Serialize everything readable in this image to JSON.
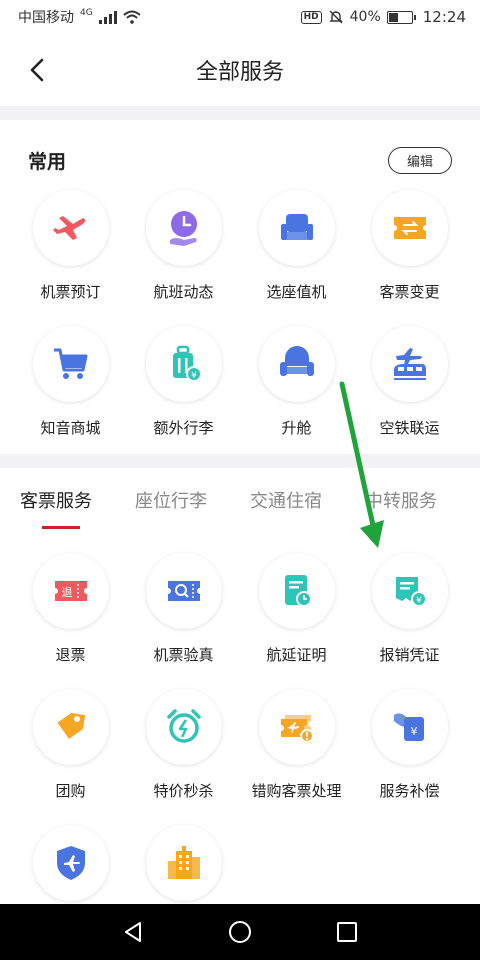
{
  "status": {
    "carrier": "中国移动",
    "network": "4G",
    "battery": "40%",
    "battery_level": 0.4,
    "time": "12:24",
    "hd": "HD"
  },
  "header": {
    "title": "全部服务"
  },
  "common": {
    "title": "常用",
    "edit": "编辑",
    "items": [
      {
        "label": "机票预订",
        "icon": "plane-icon"
      },
      {
        "label": "航班动态",
        "icon": "clock-hand-icon"
      },
      {
        "label": "选座值机",
        "icon": "seat-icon"
      },
      {
        "label": "客票变更",
        "icon": "ticket-exchange-icon"
      },
      {
        "label": "知音商城",
        "icon": "cart-icon"
      },
      {
        "label": "额外行李",
        "icon": "luggage-icon"
      },
      {
        "label": "升舱",
        "icon": "armchair-icon"
      },
      {
        "label": "空铁联运",
        "icon": "plane-train-icon"
      }
    ]
  },
  "tabs": [
    {
      "label": "客票服务"
    },
    {
      "label": "座位行李"
    },
    {
      "label": "交通住宿"
    },
    {
      "label": "中转服务"
    }
  ],
  "services": {
    "items": [
      {
        "label": "退票",
        "icon": "refund-ticket-icon"
      },
      {
        "label": "机票验真",
        "icon": "verify-ticket-icon"
      },
      {
        "label": "航延证明",
        "icon": "delay-certificate-icon"
      },
      {
        "label": "报销凭证",
        "icon": "receipt-icon"
      },
      {
        "label": "团购",
        "icon": "tag-icon"
      },
      {
        "label": "特价秒杀",
        "icon": "alarm-clock-icon"
      },
      {
        "label": "错购客票处理",
        "icon": "wrong-ticket-icon"
      },
      {
        "label": "服务补偿",
        "icon": "compensation-icon"
      },
      {
        "label": "",
        "icon": "shield-plane-icon"
      },
      {
        "label": "",
        "icon": "buildings-icon"
      }
    ]
  },
  "colors": {
    "accent": "#d0202a",
    "red": "#ef5a5f",
    "purple": "#8e6ae6",
    "blue": "#4a74e0",
    "orange": "#f5a623",
    "teal": "#2ec4b6",
    "arrow": "#1fa33a"
  }
}
